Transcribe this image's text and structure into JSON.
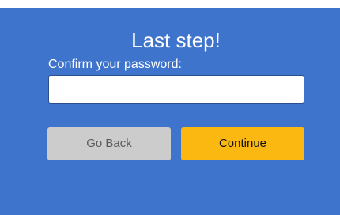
{
  "dialog": {
    "title": "Last step!",
    "password_label": "Confirm your password:",
    "password_value": "",
    "password_placeholder": "",
    "back_label": "Go Back",
    "continue_label": "Continue"
  },
  "colors": {
    "panel_background": "#3f74cc",
    "continue_button": "#fbb811",
    "back_button": "#cccccc",
    "text_light": "#ffffff"
  }
}
